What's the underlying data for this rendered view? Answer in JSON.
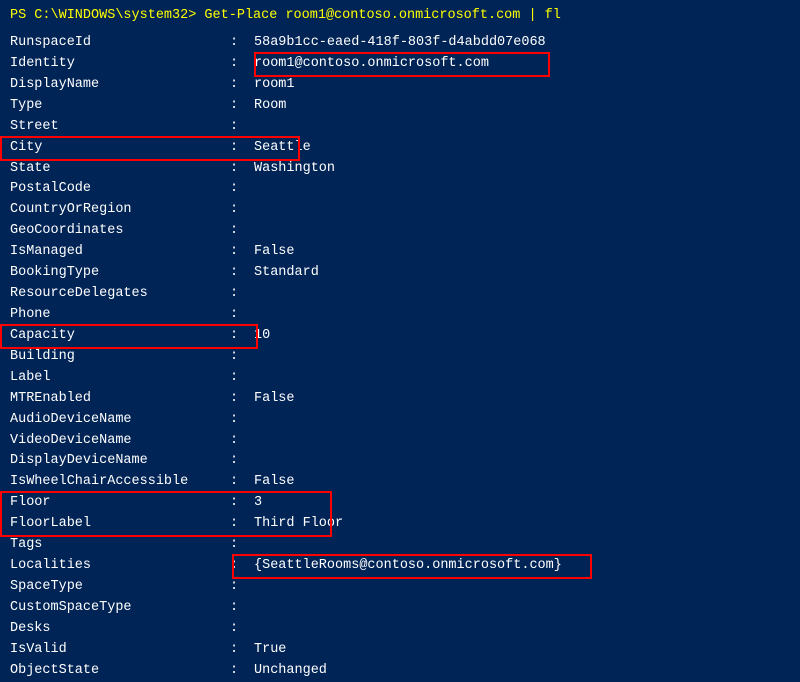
{
  "terminal": {
    "command": "PS C:\\WINDOWS\\system32> Get-Place room1@contoso.onmicrosoft.com | fl",
    "properties": [
      {
        "name": "RunspaceId",
        "value": "58a9b1cc-eaed-418f-803f-d4abdd07e068"
      },
      {
        "name": "Identity",
        "value": "room1@contoso.onmicrosoft.com"
      },
      {
        "name": "DisplayName",
        "value": "room1"
      },
      {
        "name": "Type",
        "value": "Room"
      },
      {
        "name": "Street",
        "value": ""
      },
      {
        "name": "City",
        "value": "Seattle"
      },
      {
        "name": "State",
        "value": "Washington"
      },
      {
        "name": "PostalCode",
        "value": ""
      },
      {
        "name": "CountryOrRegion",
        "value": ""
      },
      {
        "name": "GeoCoordinates",
        "value": ""
      },
      {
        "name": "IsManaged",
        "value": "False"
      },
      {
        "name": "BookingType",
        "value": "Standard"
      },
      {
        "name": "ResourceDelegates",
        "value": ""
      },
      {
        "name": "Phone",
        "value": ""
      },
      {
        "name": "Capacity",
        "value": "10"
      },
      {
        "name": "Building",
        "value": ""
      },
      {
        "name": "Label",
        "value": ""
      },
      {
        "name": "MTREnabled",
        "value": "False"
      },
      {
        "name": "AudioDeviceName",
        "value": ""
      },
      {
        "name": "VideoDeviceName",
        "value": ""
      },
      {
        "name": "DisplayDeviceName",
        "value": ""
      },
      {
        "name": "IsWheelChairAccessible",
        "value": "False"
      },
      {
        "name": "Floor",
        "value": "3"
      },
      {
        "name": "FloorLabel",
        "value": "Third Floor"
      },
      {
        "name": "Tags",
        "value": ""
      },
      {
        "name": "Localities",
        "value": "{SeattleRooms@contoso.onmicrosoft.com}"
      },
      {
        "name": "SpaceType",
        "value": ""
      },
      {
        "name": "CustomSpaceType",
        "value": ""
      },
      {
        "name": "Desks",
        "value": ""
      },
      {
        "name": "IsValid",
        "value": "True"
      },
      {
        "name": "ObjectState",
        "value": "Unchanged"
      }
    ],
    "separator": ": "
  }
}
